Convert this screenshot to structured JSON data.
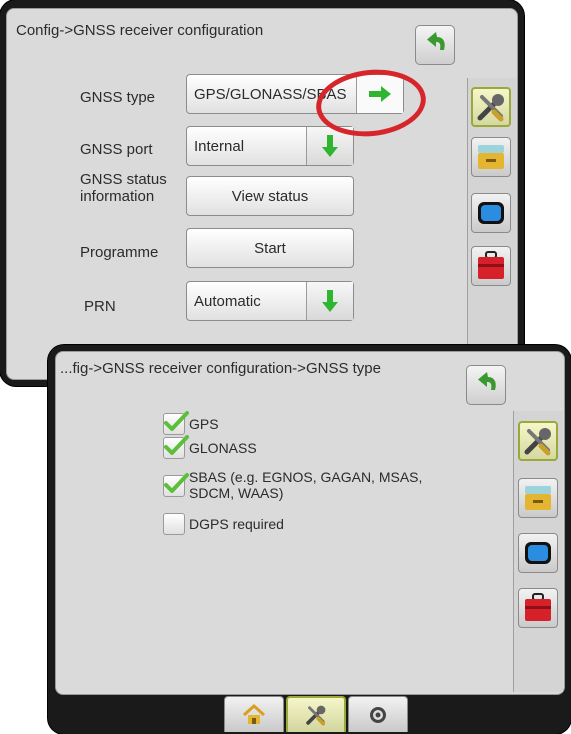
{
  "screen1": {
    "title": "Config->GNSS receiver configuration",
    "rows": [
      {
        "label": "GNSS type",
        "value": "GPS/GLONASS/SBAS"
      },
      {
        "label": "GNSS port",
        "value": "Internal"
      },
      {
        "label": "GNSS status information",
        "value": "View status"
      },
      {
        "label": "Programme",
        "value": "Start"
      },
      {
        "label": "PRN",
        "value": "Automatic"
      }
    ]
  },
  "screen2": {
    "title": "...fig->GNSS receiver configuration->GNSS type",
    "checkboxes": [
      {
        "label": "GPS",
        "checked": true
      },
      {
        "label": "GLONASS",
        "checked": true
      },
      {
        "label": "SBAS (e.g. EGNOS, GAGAN, MSAS, SDCM, WAAS)",
        "checked": true
      },
      {
        "label": "DGPS required",
        "checked": false
      }
    ]
  },
  "sidebar": {
    "icons": [
      "tools-icon",
      "console-icon",
      "display-icon",
      "toolbox-icon"
    ]
  },
  "bottom_tabs": {
    "icons": [
      "home-icon",
      "tools-icon",
      "gnss-icon"
    ],
    "active": "tools-icon"
  },
  "colors": {
    "accent_green": "#2fb52f",
    "back_arrow_green": "#3a9a2f",
    "highlight_ring": "#d7262b",
    "active_border": "#9aa93a",
    "panel_bg": "#dadada",
    "bezel": "#1a1a1a"
  }
}
